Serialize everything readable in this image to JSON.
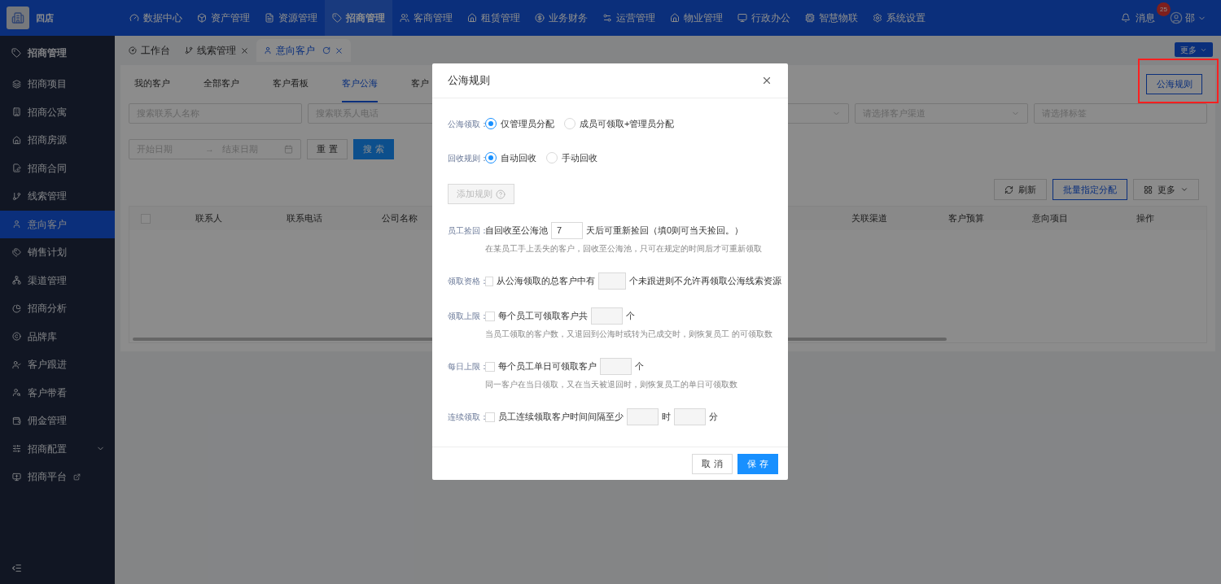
{
  "app": {
    "name": "四店"
  },
  "top_nav": {
    "items": [
      {
        "label": "数据中心",
        "selected": false
      },
      {
        "label": "资产管理",
        "selected": false
      },
      {
        "label": "资源管理",
        "selected": false
      },
      {
        "label": "招商管理",
        "selected": true
      },
      {
        "label": "客商管理",
        "selected": false
      },
      {
        "label": "租赁管理",
        "selected": false
      },
      {
        "label": "业务财务",
        "selected": false
      },
      {
        "label": "运营管理",
        "selected": false
      },
      {
        "label": "物业管理",
        "selected": false
      },
      {
        "label": "行政办公",
        "selected": false
      },
      {
        "label": "智慧物联",
        "selected": false
      },
      {
        "label": "系统设置",
        "selected": false
      }
    ],
    "messages": {
      "label": "消息",
      "badge": "25"
    },
    "user": "邵"
  },
  "sidebar": {
    "title": "招商管理",
    "items": [
      {
        "label": "招商项目",
        "selected": false,
        "kind": "page"
      },
      {
        "label": "招商公寓",
        "selected": false,
        "kind": "page"
      },
      {
        "label": "招商房源",
        "selected": false,
        "kind": "page"
      },
      {
        "label": "招商合同",
        "selected": false,
        "kind": "page"
      },
      {
        "label": "线索管理",
        "selected": false,
        "kind": "page"
      },
      {
        "label": "意向客户",
        "selected": true,
        "kind": "page"
      },
      {
        "label": "销售计划",
        "selected": false,
        "kind": "page"
      },
      {
        "label": "渠道管理",
        "selected": false,
        "kind": "page"
      },
      {
        "label": "招商分析",
        "selected": false,
        "kind": "page"
      },
      {
        "label": "品牌库",
        "selected": false,
        "kind": "page"
      },
      {
        "label": "客户跟进",
        "selected": false,
        "kind": "page"
      },
      {
        "label": "客户带看",
        "selected": false,
        "kind": "page"
      },
      {
        "label": "佣金管理",
        "selected": false,
        "kind": "page"
      },
      {
        "label": "招商配置",
        "selected": false,
        "kind": "group",
        "expanded": false
      },
      {
        "label": "招商平台",
        "selected": false,
        "kind": "external"
      }
    ]
  },
  "page_tabs": [
    {
      "label": "工作台",
      "selected": false,
      "closable": false
    },
    {
      "label": "线索管理",
      "selected": false,
      "closable": true
    },
    {
      "label": "意向客户",
      "selected": true,
      "closable": true
    }
  ],
  "more_button": "更多",
  "customer_tabs": [
    {
      "label": "我的客户",
      "selected": false
    },
    {
      "label": "全部客户",
      "selected": false
    },
    {
      "label": "客户看板",
      "selected": false
    },
    {
      "label": "客户公海",
      "selected": true
    },
    {
      "label": "客户",
      "selected": false
    }
  ],
  "rules_button": {
    "label": "公海规则",
    "highlighted": true
  },
  "filters": [
    {
      "kind": "input",
      "placeholder": "搜索联系人名称"
    },
    {
      "kind": "input",
      "placeholder": "搜索联系人电话"
    },
    {
      "kind": "select"
    },
    {
      "kind": "select",
      "placeholder": "请选择客户渠道"
    },
    {
      "kind": "input",
      "placeholder": "请选择标签"
    }
  ],
  "date_range": {
    "start_placeholder": "开始日期",
    "separator": "→",
    "end_placeholder": "结束日期"
  },
  "reset_button": "重 置",
  "search_button": "搜 索",
  "actions": {
    "refresh": "刷新",
    "batch": "批量指定分配",
    "more": "更多"
  },
  "table": {
    "select_all_checked": false,
    "columns_left": [
      "联系人",
      "联系电话",
      "公司名称"
    ],
    "columns_right": [
      "关联渠道",
      "客户预算",
      "意向项目",
      "操作"
    ]
  },
  "dialog": {
    "title": "公海规则",
    "rows": [
      {
        "kind": "radio",
        "label": "公海领取：",
        "options": [
          {
            "label": "仅管理员分配",
            "selected": true
          },
          {
            "label": "成员可领取+管理员分配",
            "selected": false
          }
        ]
      },
      {
        "kind": "radio",
        "label": "回收规则：",
        "options": [
          {
            "label": "自动回收",
            "selected": true
          },
          {
            "label": "手动回收",
            "selected": false
          }
        ]
      },
      {
        "kind": "button",
        "label": "添加规则",
        "disabled": true
      },
      {
        "kind": "sentence",
        "label": "员工捡回：",
        "parts": [
          {
            "kind": "text",
            "text": "自回收至公海池"
          },
          {
            "kind": "field",
            "value": "7"
          },
          {
            "kind": "text",
            "text": "天后可重新捡回（填0则可当天捡回。）"
          }
        ],
        "hint": "在某员工手上丢失的客户，回收至公海池，只可在规定的时间后才可重新领取"
      },
      {
        "kind": "checkbox",
        "label": "领取资格：",
        "checked": false,
        "parts": [
          {
            "kind": "text",
            "text": "从公海领取的总客户中有"
          },
          {
            "kind": "field"
          },
          {
            "kind": "text",
            "text": "个未跟进则不允许再领取公海线索资源"
          }
        ]
      },
      {
        "kind": "checkbox",
        "label": "领取上限：",
        "checked": false,
        "parts": [
          {
            "kind": "text",
            "text": "每个员工可领取客户共"
          },
          {
            "kind": "field"
          },
          {
            "kind": "text",
            "text": "个"
          }
        ],
        "hint": "当员工领取的客户数，又退回到公海时或转为已成交时，则恢复员工 的可领取数"
      },
      {
        "kind": "checkbox",
        "label": "每日上限：",
        "checked": false,
        "parts": [
          {
            "kind": "text",
            "text": "每个员工单日可领取客户"
          },
          {
            "kind": "field"
          },
          {
            "kind": "text",
            "text": "个"
          }
        ],
        "hint": "同一客户在当日领取，又在当天被退回时，则恢复员工的单日可领取数"
      },
      {
        "kind": "checkbox",
        "label": "连续领取：",
        "checked": false,
        "parts": [
          {
            "kind": "text",
            "text": "员工连续领取客户时间间隔至少"
          },
          {
            "kind": "field"
          },
          {
            "kind": "text",
            "text": "时"
          },
          {
            "kind": "field"
          },
          {
            "kind": "text",
            "text": "分"
          }
        ]
      }
    ],
    "cancel": "取 消",
    "save": "保 存"
  }
}
